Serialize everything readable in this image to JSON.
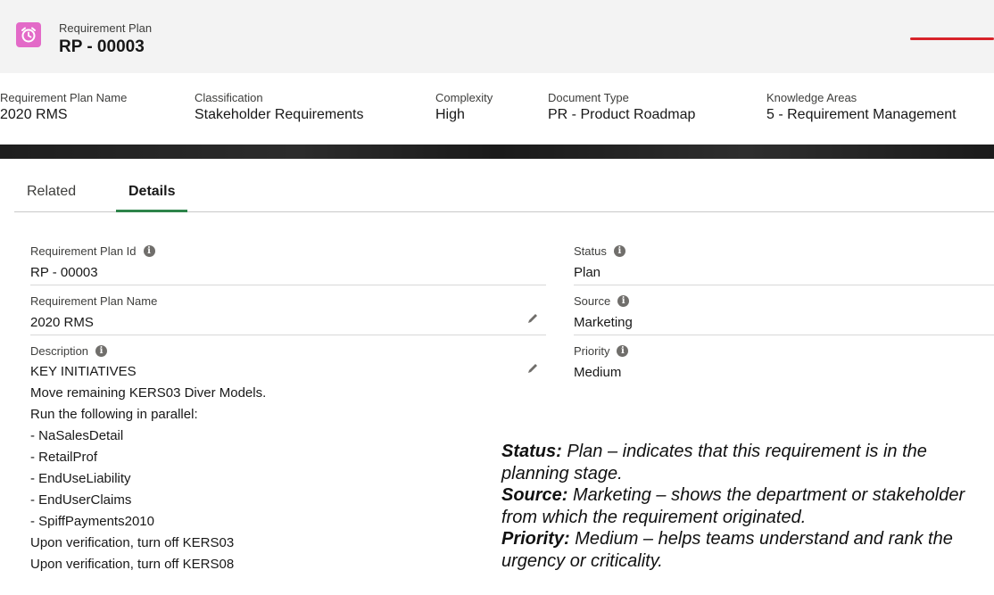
{
  "record": {
    "object_label": "Requirement Plan",
    "title": "RP - 00003",
    "object_icon": "alarm-clock-icon",
    "icon_color": "#e36ac8"
  },
  "highlights": [
    {
      "label": "Requirement Plan Name",
      "value": "2020 RMS"
    },
    {
      "label": "Classification",
      "value": "Stakeholder Requirements"
    },
    {
      "label": "Complexity",
      "value": "High"
    },
    {
      "label": "Document Type",
      "value": "PR - Product Roadmap"
    },
    {
      "label": "Knowledge Areas",
      "value": "5 - Requirement Management"
    }
  ],
  "tabs": [
    {
      "label": "Related",
      "active": false
    },
    {
      "label": "Details",
      "active": true
    }
  ],
  "fields": {
    "plan_id": {
      "label": "Requirement Plan Id",
      "value": "RP - 00003"
    },
    "plan_name": {
      "label": "Requirement Plan Name",
      "value": "2020 RMS"
    },
    "description": {
      "label": "Description",
      "lines": [
        "KEY INITIATIVES",
        "Move remaining KERS03 Diver Models.",
        "Run the following in parallel:",
        "- NaSalesDetail",
        "- RetailProf",
        "- EndUseLiability",
        "- EndUserClaims",
        "- SpiffPayments2010",
        "Upon verification, turn off KERS03",
        "Upon verification, turn off KERS08"
      ]
    },
    "status": {
      "label": "Status",
      "value": "Plan"
    },
    "source": {
      "label": "Source",
      "value": "Marketing"
    },
    "priority": {
      "label": "Priority",
      "value": "Medium"
    }
  },
  "annotation": {
    "status_term": "Status:",
    "status_text": " Plan – indicates that this requirement is in the planning stage.",
    "source_term": "Source:",
    "source_text": " Marketing – shows the department or stakeholder from which the requirement originated.",
    "priority_term": "Priority:",
    "priority_text": " Medium – helps teams understand and rank the urgency or criticality."
  },
  "colors": {
    "active_tab": "#2e844a",
    "accent_line": "#d8232a"
  }
}
